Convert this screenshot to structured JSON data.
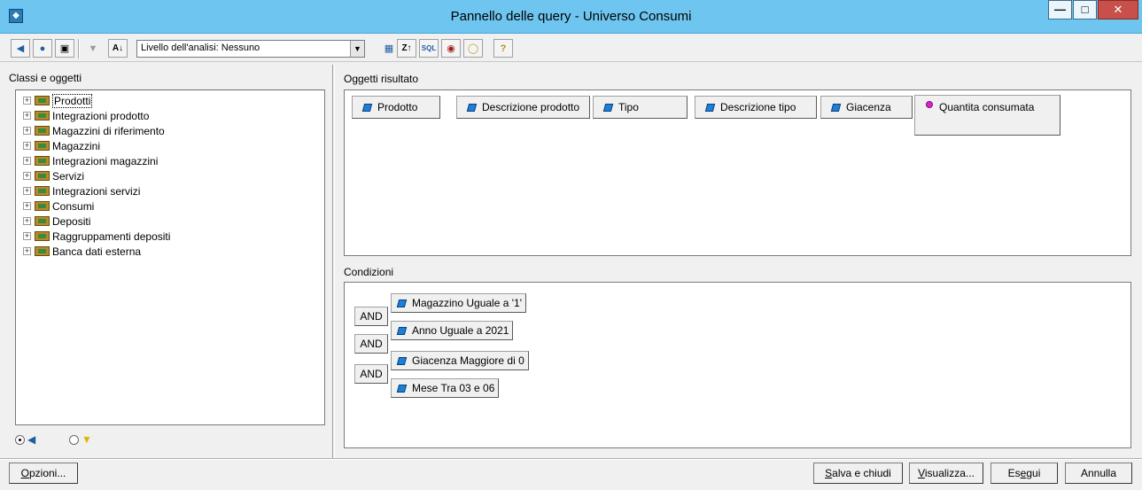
{
  "window": {
    "title": "Pannello delle query - Universo Consumi"
  },
  "toolbar": {
    "level_select_value": "Livello dell'analisi: Nessuno"
  },
  "left_panel": {
    "label": "Classi e oggetti",
    "tree": [
      {
        "label": "Prodotti",
        "selected": true
      },
      {
        "label": "Integrazioni prodotto"
      },
      {
        "label": "Magazzini di riferimento"
      },
      {
        "label": "Magazzini"
      },
      {
        "label": "Integrazioni magazzini"
      },
      {
        "label": "Servizi"
      },
      {
        "label": "Integrazioni servizi"
      },
      {
        "label": "Consumi"
      },
      {
        "label": "Depositi"
      },
      {
        "label": "Raggruppamenti depositi"
      },
      {
        "label": "Banca dati esterna"
      }
    ],
    "view_mode": "objects"
  },
  "result": {
    "label": "Oggetti risultato",
    "objects": [
      {
        "label": "Prodotto",
        "kind": "dimension"
      },
      {
        "label": "Descrizione prodotto",
        "kind": "dimension"
      },
      {
        "label": "Tipo",
        "kind": "dimension"
      },
      {
        "label": "Descrizione tipo",
        "kind": "dimension"
      },
      {
        "label": "Giacenza",
        "kind": "dimension"
      },
      {
        "label": "Quantita consumata",
        "kind": "measure"
      }
    ]
  },
  "conditions": {
    "label": "Condizioni",
    "operators": [
      "AND",
      "AND",
      "AND"
    ],
    "items": [
      {
        "label": "Magazzino Uguale a '1'"
      },
      {
        "label": "Anno Uguale a 2021"
      },
      {
        "label": "Giacenza Maggiore di 0"
      },
      {
        "label": "Mese Tra 03 e 06"
      }
    ]
  },
  "buttons": {
    "options": {
      "mnemonic": "O",
      "rest": "pzioni..."
    },
    "save_close": {
      "mnemonic": "S",
      "rest": "alva e chiudi"
    },
    "view": {
      "mnemonic": "V",
      "rest": "isualizza..."
    },
    "run": {
      "prefix": "Es",
      "mnemonic": "e",
      "rest": "gui"
    },
    "cancel": {
      "label": "Annulla"
    }
  },
  "colors": {
    "titlebar": "#6ec6f0",
    "close_button": "#c7504a",
    "dimension_icon": "#1e7fd6",
    "measure_icon": "#e020d0"
  }
}
